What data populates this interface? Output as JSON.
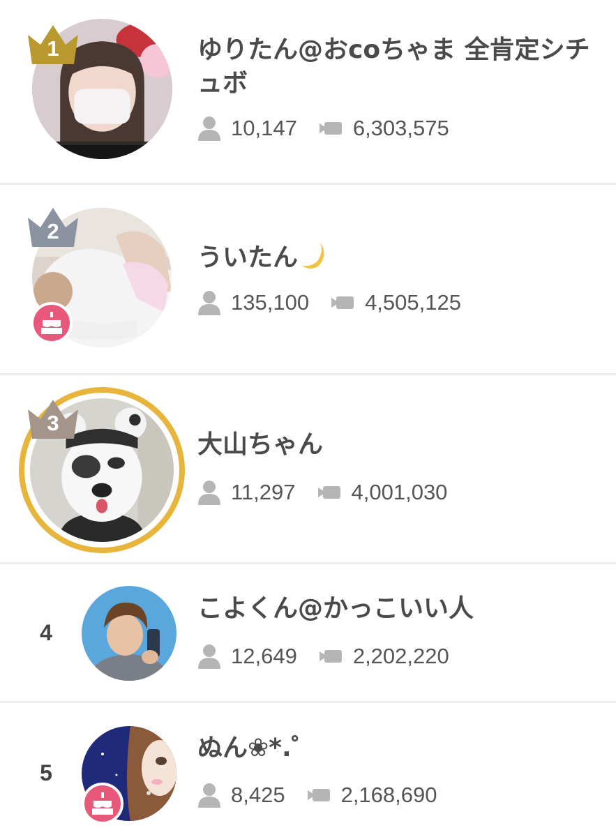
{
  "ranking": [
    {
      "rank": "1",
      "name": "ゆりたん@おcoちゃま 全肯定シチュボ",
      "followers": "10,147",
      "views": "6,303,575",
      "crown": "gold-crown-icon",
      "crown_color": "#b9992f"
    },
    {
      "rank": "2",
      "name": "ういたん",
      "name_emoji": "crescent-moon-emoji",
      "followers": "135,100",
      "views": "4,505,125",
      "crown": "silver-crown-icon",
      "crown_color": "#8b93a0",
      "badge": "birthday-cake-icon"
    },
    {
      "rank": "3",
      "name": "大山ちゃん",
      "followers": "11,297",
      "views": "4,001,030",
      "crown": "bronze-crown-icon",
      "crown_color": "#a39589",
      "ring_color": "#e7b43c"
    },
    {
      "rank": "4",
      "name": "こよくん@かっこいい人",
      "followers": "12,649",
      "views": "2,202,220"
    },
    {
      "rank": "5",
      "name": "ぬん❀*.゜",
      "followers": "8,425",
      "views": "2,168,690",
      "badge": "birthday-cake-icon"
    }
  ],
  "icons": {
    "followers": "person-icon",
    "views": "video-camera-icon"
  },
  "colors": {
    "badge_pink": "#e8587a",
    "icon_gray": "#b5b5b5",
    "text": "#4a4a4a"
  }
}
